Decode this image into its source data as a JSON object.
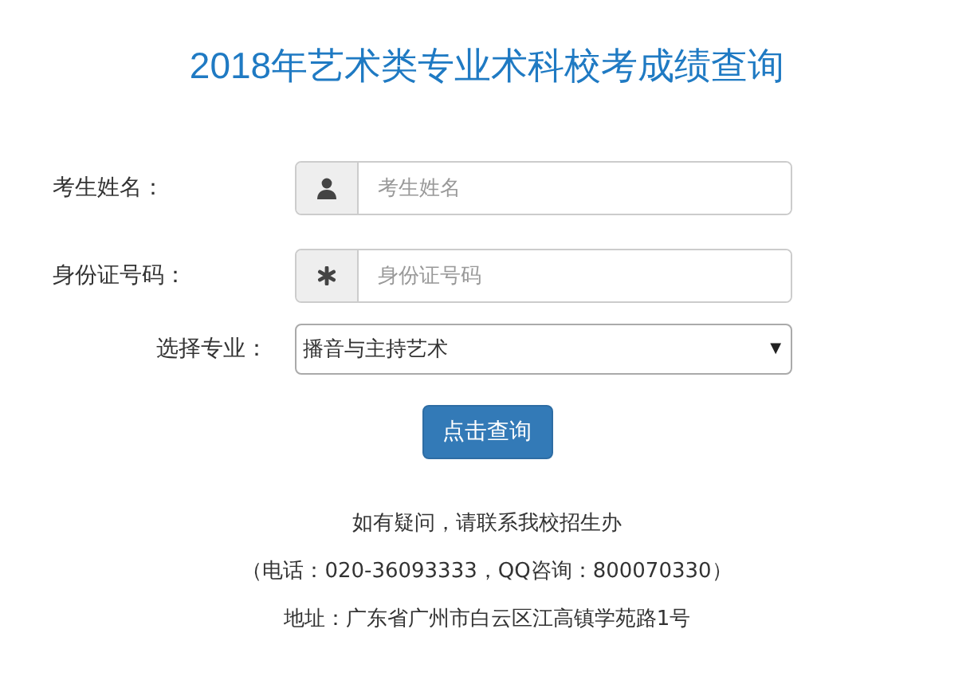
{
  "title": "2018年艺术类专业术科校考成绩查询",
  "fields": [
    {
      "kind": "input",
      "label": "考生姓名：",
      "placeholder": "考生姓名"
    },
    {
      "kind": "input",
      "label": "身份证号码：",
      "placeholder": "身份证号码"
    },
    {
      "kind": "select",
      "label": "选择专业：",
      "value": "播音与主持艺术",
      "caret": "▼"
    }
  ],
  "submit": "点击查询",
  "footer": [
    "如有疑问，请联系我校招生办",
    "（电话：020-36093333，QQ咨询：800070330）",
    "地址：广东省广州市白云区江高镇学苑路1号"
  ]
}
